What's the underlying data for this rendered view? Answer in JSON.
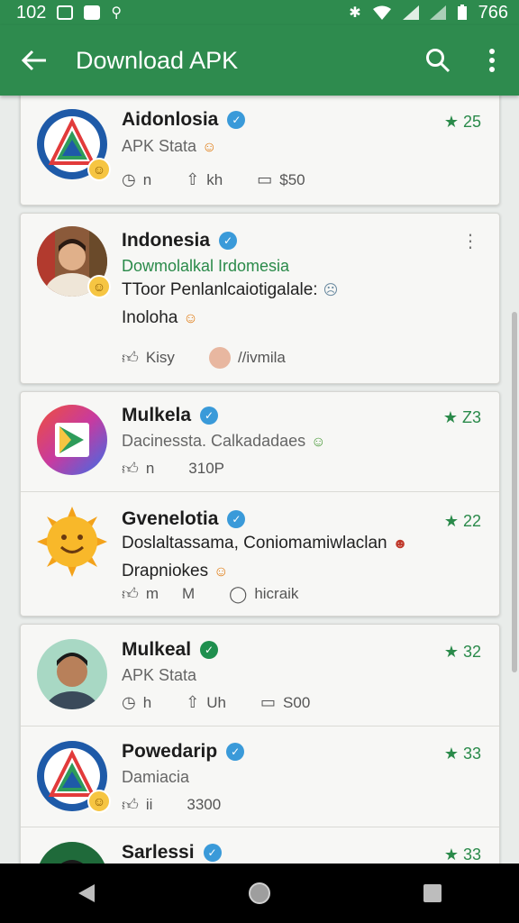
{
  "status_bar": {
    "time": "102",
    "battery": "766"
  },
  "app_bar": {
    "title": "Download APK"
  },
  "feed": [
    {
      "name": "Aidonlosia",
      "subtitle": "APK Stata",
      "rating": "25",
      "meta": [
        {
          "icon": "clock-icon",
          "text": "n"
        },
        {
          "icon": "share-icon",
          "text": "kh"
        },
        {
          "icon": "comment-icon",
          "text": "$50"
        }
      ]
    },
    {
      "name": "Indonesia",
      "subtitle": "Dowmolalkal Irdomesia",
      "body": [
        "TToor Penlanlcaiotigalale:",
        "Inoloha"
      ],
      "meta": [
        {
          "icon": "thumbs-up-icon",
          "text": "Kisy"
        },
        {
          "icon": "user-icon",
          "text": "//ivmila"
        }
      ]
    },
    {
      "name": "Mulkela",
      "subtitle": "Dacinessta. Calkadadaes",
      "rating": "Z3",
      "meta": [
        {
          "icon": "thumbs-up-icon",
          "text": "n"
        },
        {
          "icon": "none",
          "text": "310P"
        }
      ]
    },
    {
      "name": "Gvenelotia",
      "rating": "22",
      "body": [
        "Doslaltassama, Coniomamiwlaclan",
        "Drapniokes"
      ],
      "meta": [
        {
          "icon": "thumbs-up-icon",
          "text": "m"
        },
        {
          "icon": "none",
          "text": "M"
        },
        {
          "icon": "comment-icon",
          "text": "hicraik"
        }
      ]
    },
    {
      "name": "Mulkeal",
      "subtitle": "APK Stata",
      "rating": "32",
      "meta": [
        {
          "icon": "clock-icon",
          "text": "h"
        },
        {
          "icon": "share-icon",
          "text": "Uh"
        },
        {
          "icon": "comment-icon",
          "text": "S00"
        }
      ]
    },
    {
      "name": "Powedarip",
      "subtitle": "Damiacia",
      "rating": "33",
      "meta": [
        {
          "icon": "thumbs-up-icon",
          "text": "ii"
        },
        {
          "icon": "none",
          "text": "3300"
        }
      ]
    },
    {
      "name": "Sarlessi",
      "rating": "33"
    }
  ],
  "colors": {
    "primary": "#2e8b4e",
    "verified_blue": "#3a9ad9",
    "rating_green": "#2a8a4a"
  }
}
